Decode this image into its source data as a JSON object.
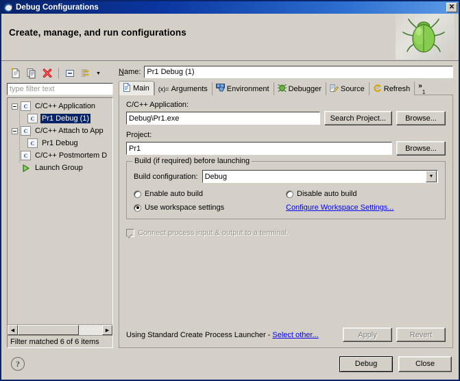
{
  "window": {
    "title": "Debug Configurations",
    "title_icon": "eclipse-icon",
    "close_label": "✕"
  },
  "header": {
    "title": "Create, manage, and run configurations",
    "graphic": "green-bug-icon"
  },
  "tree_toolbar": {
    "buttons": [
      {
        "name": "new-launch-configuration-button",
        "icon": "new-document-icon"
      },
      {
        "name": "duplicate-launch-configuration-button",
        "icon": "copy-icon"
      },
      {
        "name": "delete-launch-configuration-button",
        "icon": "red-x-delete-icon"
      },
      {
        "name": "collapse-all-button",
        "icon": "collapse-all-icon"
      },
      {
        "name": "filter-launch-configurations-button",
        "icon": "filter-icon"
      }
    ],
    "menu_arrow": "▼"
  },
  "filter": {
    "placeholder": "type filter text",
    "value": "",
    "status": "Filter matched 6 of 6 items"
  },
  "tree": {
    "items": [
      {
        "label": "C/C++ Application",
        "icon": "c-file-icon",
        "indent": 0,
        "expanded": true,
        "selected": false,
        "twisty": true
      },
      {
        "label": "Pr1 Debug (1)",
        "icon": "c-file-icon",
        "indent": 1,
        "expanded": false,
        "selected": true,
        "twisty": false
      },
      {
        "label": "C/C++ Attach to App",
        "icon": "c-file-icon",
        "indent": 0,
        "expanded": true,
        "selected": false,
        "twisty": true
      },
      {
        "label": "Pr1 Debug",
        "icon": "c-file-icon",
        "indent": 1,
        "expanded": false,
        "selected": false,
        "twisty": false
      },
      {
        "label": "C/C++ Postmortem D",
        "icon": "c-file-icon",
        "indent": 0,
        "expanded": false,
        "selected": false,
        "twisty": false
      },
      {
        "label": "Launch Group",
        "icon": "green-play-icon",
        "indent": 0,
        "expanded": false,
        "selected": false,
        "twisty": false
      }
    ]
  },
  "name_field": {
    "label": "Name:",
    "label_mnemonic": "N",
    "value": "Pr1 Debug (1)"
  },
  "tabs": [
    {
      "label": "Main",
      "icon": "document-icon",
      "active": true
    },
    {
      "label": "Arguments",
      "icon": "variables-icon",
      "active": false
    },
    {
      "label": "Environment",
      "icon": "environment-icon",
      "active": false
    },
    {
      "label": "Debugger",
      "icon": "debugger-icon",
      "active": false
    },
    {
      "label": "Source",
      "icon": "source-icon",
      "active": false
    },
    {
      "label": "Refresh",
      "icon": "refresh-icon",
      "active": false
    }
  ],
  "tab_overflow": {
    "symbol": "»",
    "count": "1"
  },
  "main_tab": {
    "application": {
      "label": "C/C++ Application:",
      "value": "Debug\\Pr1.exe",
      "search_button": "Search Project...",
      "search_mnemonic": "h",
      "browse_button": "Browse...",
      "browse_mnemonic": "o"
    },
    "project": {
      "label": "Project:",
      "value": "Pr1",
      "browse_button": "Browse...",
      "browse_mnemonic": "B"
    },
    "build_group": {
      "title": "Build (if required) before launching",
      "config_label": "Build configuration:",
      "config_value": "Debug",
      "config_options": [
        "Debug"
      ],
      "radios": [
        {
          "label": "Enable auto build",
          "checked": false
        },
        {
          "label": "Disable auto build",
          "checked": false
        },
        {
          "label": "Use workspace settings",
          "checked": true
        }
      ],
      "configure_link": "Configure Workspace Settings..."
    },
    "terminal_checkbox": {
      "label": "Connect process input & output to a terminal.",
      "checked": true,
      "disabled": true
    },
    "launcher": {
      "text": "Using Standard Create Process Launcher - ",
      "link": "Select other...",
      "apply_button": "Apply",
      "apply_mnemonic": "y",
      "apply_disabled": true,
      "revert_button": "Revert",
      "revert_mnemonic": "v",
      "revert_disabled": true
    }
  },
  "footer": {
    "help_icon": "question-mark-icon",
    "debug_button": "Debug",
    "debug_mnemonic": "D",
    "close_button": "Close"
  },
  "colors": {
    "titlebar_start": "#0a246a",
    "titlebar_end": "#5c9ae6",
    "dialog_bg": "#d4d0c8",
    "selection": "#0a246a",
    "link": "#0000ff",
    "disabled_text": "#9a968e",
    "bug_green": "#7ec64a"
  }
}
